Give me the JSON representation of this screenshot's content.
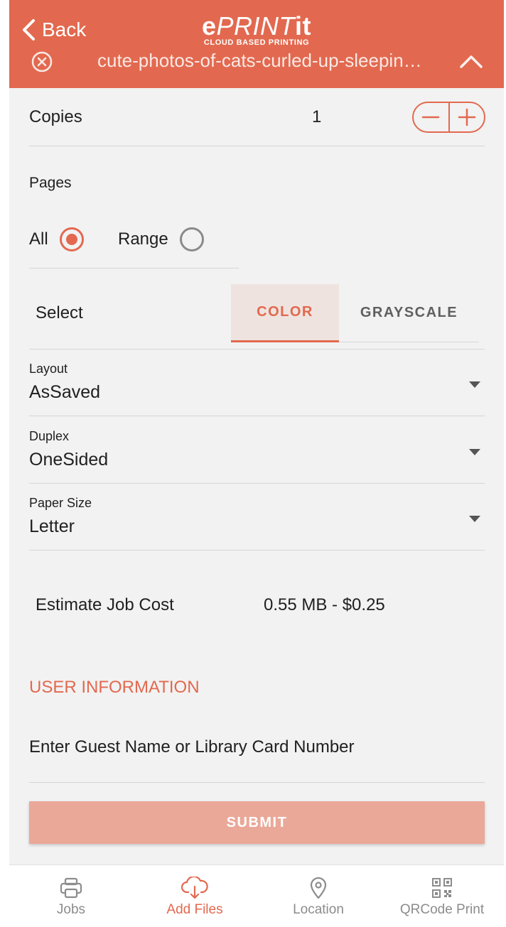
{
  "header": {
    "back_label": "Back",
    "logo_e": "e",
    "logo_mid": "PRINT",
    "logo_end": "it",
    "logo_sub": "CLOUD BASED PRINTING",
    "file_name": "cute-photos-of-cats-curled-up-sleeping.jpg"
  },
  "copies": {
    "label": "Copies",
    "value": "1"
  },
  "pages": {
    "title": "Pages",
    "all_label": "All",
    "range_label": "Range",
    "selected": "All"
  },
  "color_select": {
    "label": "Select",
    "options": [
      "COLOR",
      "GRAYSCALE"
    ],
    "selected": "COLOR"
  },
  "layout": {
    "caption": "Layout",
    "value": "AsSaved"
  },
  "duplex": {
    "caption": "Duplex",
    "value": "OneSided"
  },
  "paper_size": {
    "caption": "Paper Size",
    "value": "Letter"
  },
  "estimate": {
    "label": "Estimate Job Cost",
    "value": "0.55 MB - $0.25"
  },
  "user_info": {
    "title": "USER INFORMATION",
    "guest_placeholder": "Enter Guest Name or Library Card Number"
  },
  "submit_label": "SUBMIT",
  "bottom_nav": {
    "items": [
      {
        "label": "Jobs",
        "icon": "printer-icon"
      },
      {
        "label": "Add Files",
        "icon": "cloud-download-icon"
      },
      {
        "label": "Location",
        "icon": "location-pin-icon"
      },
      {
        "label": "QRCode Print",
        "icon": "qr-code-icon"
      }
    ],
    "active": "Add Files"
  },
  "colors": {
    "accent": "#e2694f",
    "submit_disabled": "#eaa899",
    "background": "#f2f2f2"
  }
}
